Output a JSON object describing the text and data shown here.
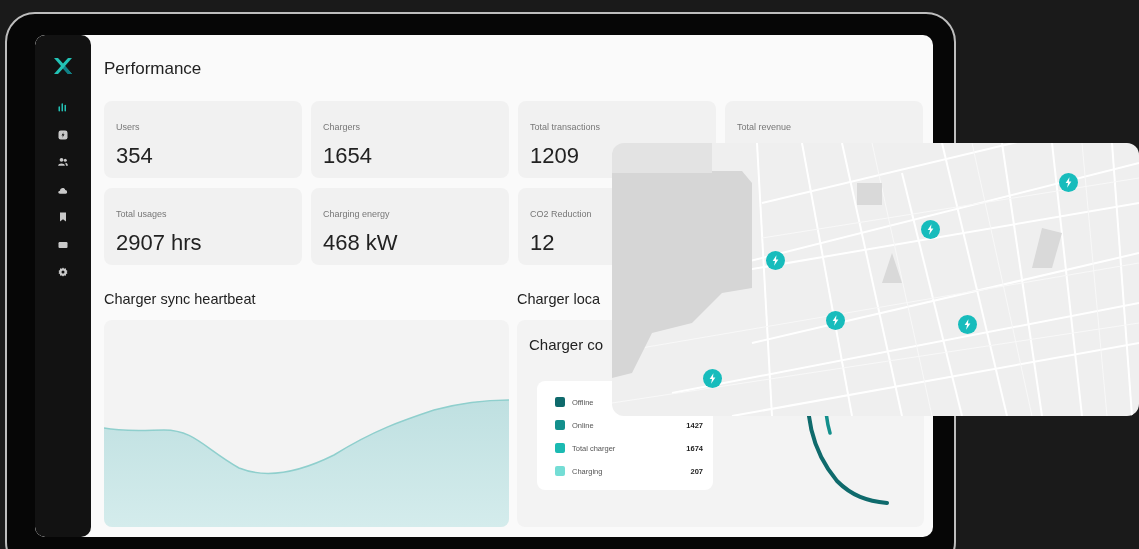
{
  "sidebar": {
    "items": [
      {
        "selected": true
      },
      {
        "selected": false
      },
      {
        "selected": false
      },
      {
        "selected": false
      },
      {
        "selected": false
      },
      {
        "selected": false
      },
      {
        "selected": false
      }
    ]
  },
  "page": {
    "title": "Performance"
  },
  "stats": [
    {
      "label": "Users",
      "value": "354"
    },
    {
      "label": "Chargers",
      "value": "1654"
    },
    {
      "label": "Total transactions",
      "value": "1209"
    },
    {
      "label": "Total revenue"
    },
    {
      "label": "Total usages",
      "value": "2907 hrs"
    },
    {
      "label": "Charging energy",
      "value": "468 kW"
    },
    {
      "label": "CO2 Reduction",
      "value": "12"
    }
  ],
  "heartbeat": {
    "title": "Charger sync heartbeat"
  },
  "locations": {
    "title": "Charger loca"
  },
  "connectivity": {
    "title": "Charger co",
    "legend": [
      {
        "label": "Offline",
        "color": "#0f6a6c"
      },
      {
        "label": "Online",
        "value": "1427",
        "color": "#138f8c"
      },
      {
        "label": "Total charger",
        "value": "1674",
        "color": "#1bbab2"
      },
      {
        "label": "Charging",
        "value": "207",
        "color": "#74ddd5"
      }
    ]
  }
}
